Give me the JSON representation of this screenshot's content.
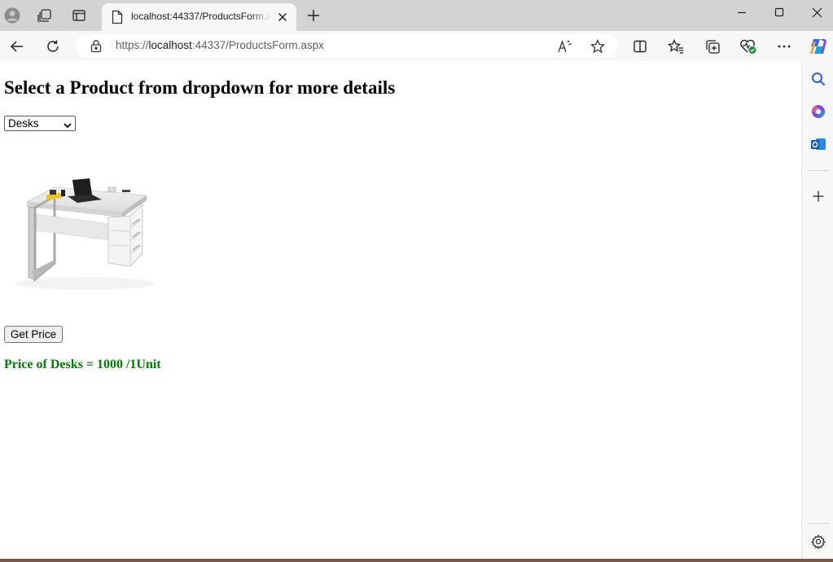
{
  "browser": {
    "tab": {
      "title": "localhost:44337/ProductsForm.aspx"
    },
    "address": {
      "scheme": "https://",
      "host": "localhost",
      "rest": ":44337/ProductsForm.aspx"
    }
  },
  "page": {
    "heading": "Select a Product from dropdown for more details",
    "product_select": {
      "selected": "Desks"
    },
    "get_price_label": "Get Price",
    "price_text": "Price of Desks = 1000 /1Unit"
  },
  "colors": {
    "price_text": "#008000",
    "titlebar": "#d3d3d3",
    "toolbar": "#f7f7f7"
  },
  "icons": {
    "titlebar": [
      "profile-icon",
      "workspaces-icon",
      "tab-actions-icon",
      "page-icon",
      "close-icon",
      "plus-icon"
    ],
    "window": [
      "minimize-icon",
      "maximize-icon",
      "close-icon"
    ],
    "toolbar": [
      "back-icon",
      "refresh-icon",
      "lock-icon",
      "read-aloud-icon",
      "favorite-star-icon",
      "split-screen-icon",
      "favorites-icon",
      "collections-icon",
      "browser-essentials-icon",
      "more-icon",
      "copilot-icon"
    ],
    "sidebar": [
      "search-icon",
      "copilot-sidebar-icon",
      "outlook-icon",
      "add-icon",
      "settings-icon"
    ]
  }
}
